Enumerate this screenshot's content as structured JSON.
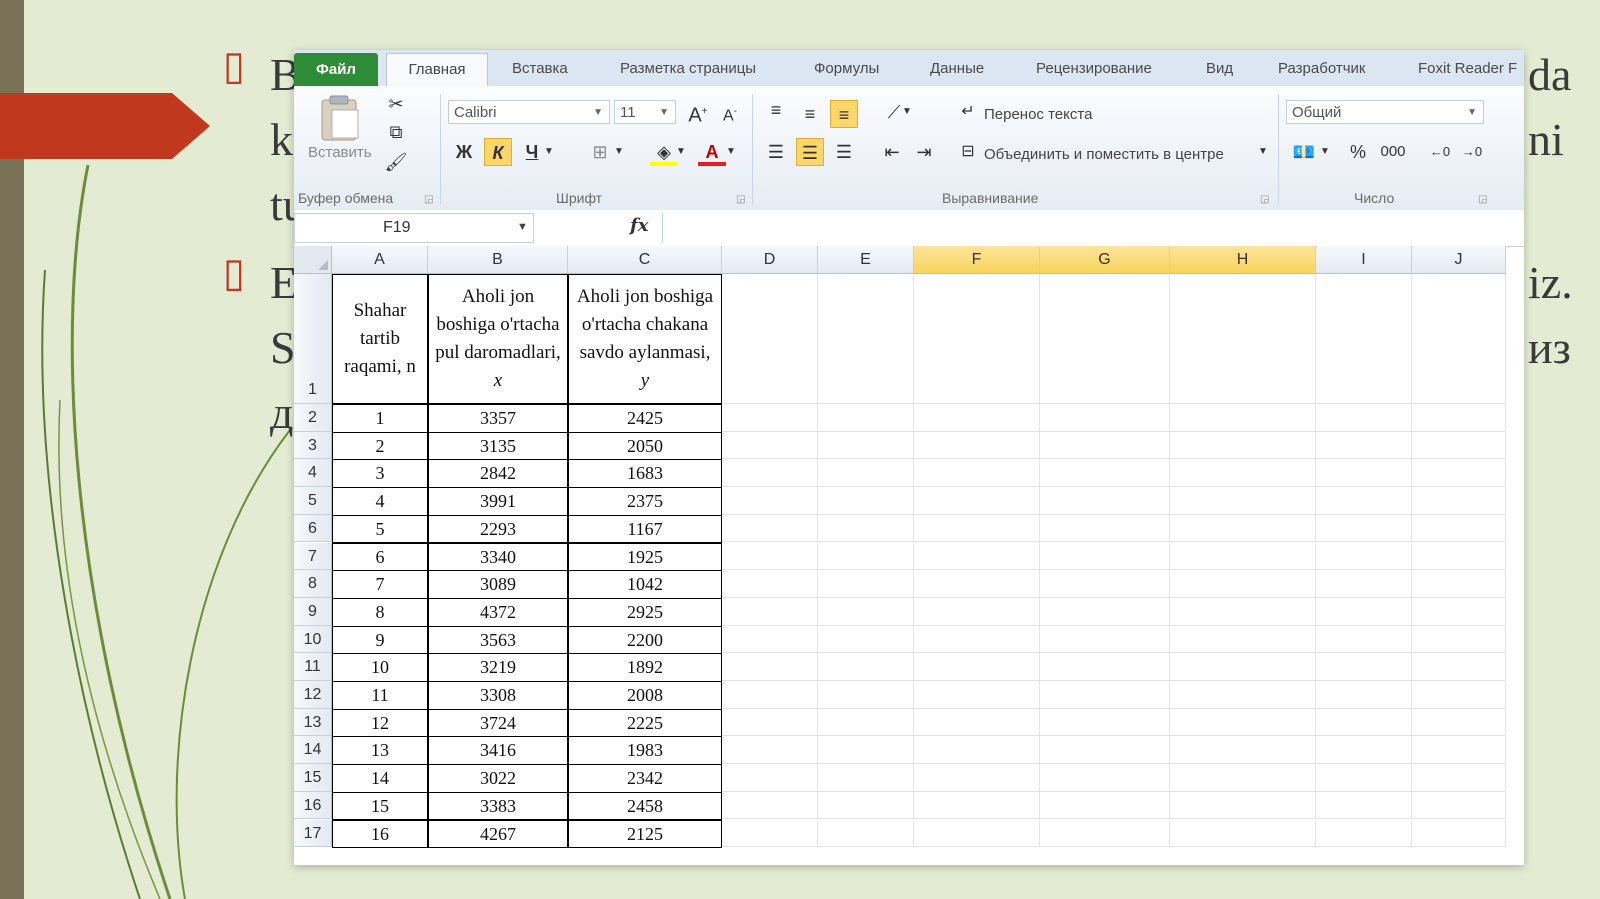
{
  "slide": {
    "bullet_glyph": "▯",
    "left_fragments": [
      "B",
      "k",
      "tu",
      "E",
      "S",
      "д"
    ],
    "right_fragments": [
      "da",
      "ni",
      "iz.",
      "из"
    ]
  },
  "ribbon": {
    "tabs": [
      "Файл",
      "Главная",
      "Вставка",
      "Разметка страницы",
      "Формулы",
      "Данные",
      "Рецензирование",
      "Вид",
      "Разработчик",
      "Foxit Reader F"
    ],
    "paste_label": "Вставить",
    "groups": {
      "clipboard": "Буфер обмена",
      "font": "Шрифт",
      "alignment": "Выравнивание",
      "number": "Число"
    },
    "font_name": "Calibri",
    "font_size": "11",
    "bold": "Ж",
    "italic": "К",
    "underline": "Ч",
    "wrap_text": "Перенос текста",
    "merge_center": "Объединить и поместить в центре",
    "number_format": "Общий",
    "percent": "%",
    "thousands": "000"
  },
  "formula_bar": {
    "name_box": "F19",
    "fx": "fx",
    "formula": ""
  },
  "sheet": {
    "columns": [
      "A",
      "B",
      "C",
      "D",
      "E",
      "F",
      "G",
      "H",
      "I",
      "J"
    ],
    "selected_columns": [
      "F",
      "G",
      "H"
    ],
    "row_numbers": [
      "1",
      "2",
      "3",
      "4",
      "5",
      "6",
      "7",
      "8",
      "9",
      "10",
      "11",
      "12",
      "13",
      "14",
      "15",
      "16",
      "17"
    ],
    "header": {
      "a": "Shahar tartib raqami, n",
      "b_text": "Aholi jon boshiga o'rtacha pul daromadlari, ",
      "b_var": "x",
      "c_text": "Aholi jon boshiga o'rtacha chakana savdo aylanmasi, ",
      "c_var": "y"
    },
    "rows": [
      [
        "1",
        "3357",
        "2425"
      ],
      [
        "2",
        "3135",
        "2050"
      ],
      [
        "3",
        "2842",
        "1683"
      ],
      [
        "4",
        "3991",
        "2375"
      ],
      [
        "5",
        "2293",
        "1167"
      ],
      [
        "6",
        "3340",
        "1925"
      ],
      [
        "7",
        "3089",
        "1042"
      ],
      [
        "8",
        "4372",
        "2925"
      ],
      [
        "9",
        "3563",
        "2200"
      ],
      [
        "10",
        "3219",
        "1892"
      ],
      [
        "11",
        "3308",
        "2008"
      ],
      [
        "12",
        "3724",
        "2225"
      ],
      [
        "13",
        "3416",
        "1983"
      ],
      [
        "14",
        "3022",
        "2342"
      ],
      [
        "15",
        "3383",
        "2458"
      ],
      [
        "16",
        "4267",
        "2125"
      ]
    ]
  },
  "colors": {
    "accent_red": "#c0391f",
    "file_tab_green": "#2e8b37",
    "selected_column": "#f7d45a",
    "slide_background": "#e3ebd2"
  }
}
